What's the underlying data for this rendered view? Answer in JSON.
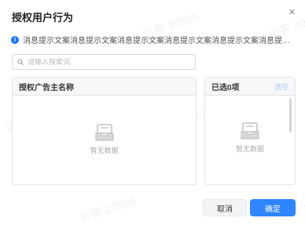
{
  "dialog": {
    "title": "授权用户行为",
    "close_glyph": "×"
  },
  "notice": {
    "icon": "info-icon",
    "text": "消息提示文案消息提示文案消息提示文案消息提示文案消息提示文案消息提示文案..."
  },
  "search": {
    "placeholder": "请输入搜索词",
    "icon": "search-icon"
  },
  "left_panel": {
    "header": "授权广告主名称",
    "empty_text": "暂无数据"
  },
  "right_panel": {
    "header": "已选0项",
    "clear_label": "清空",
    "empty_text": "暂无数据"
  },
  "footer": {
    "cancel_label": "取消",
    "confirm_label": "确定"
  },
  "watermark": {
    "text": "访客 20585"
  },
  "colors": {
    "primary": "#2e85ff",
    "info": "#1677ff"
  }
}
